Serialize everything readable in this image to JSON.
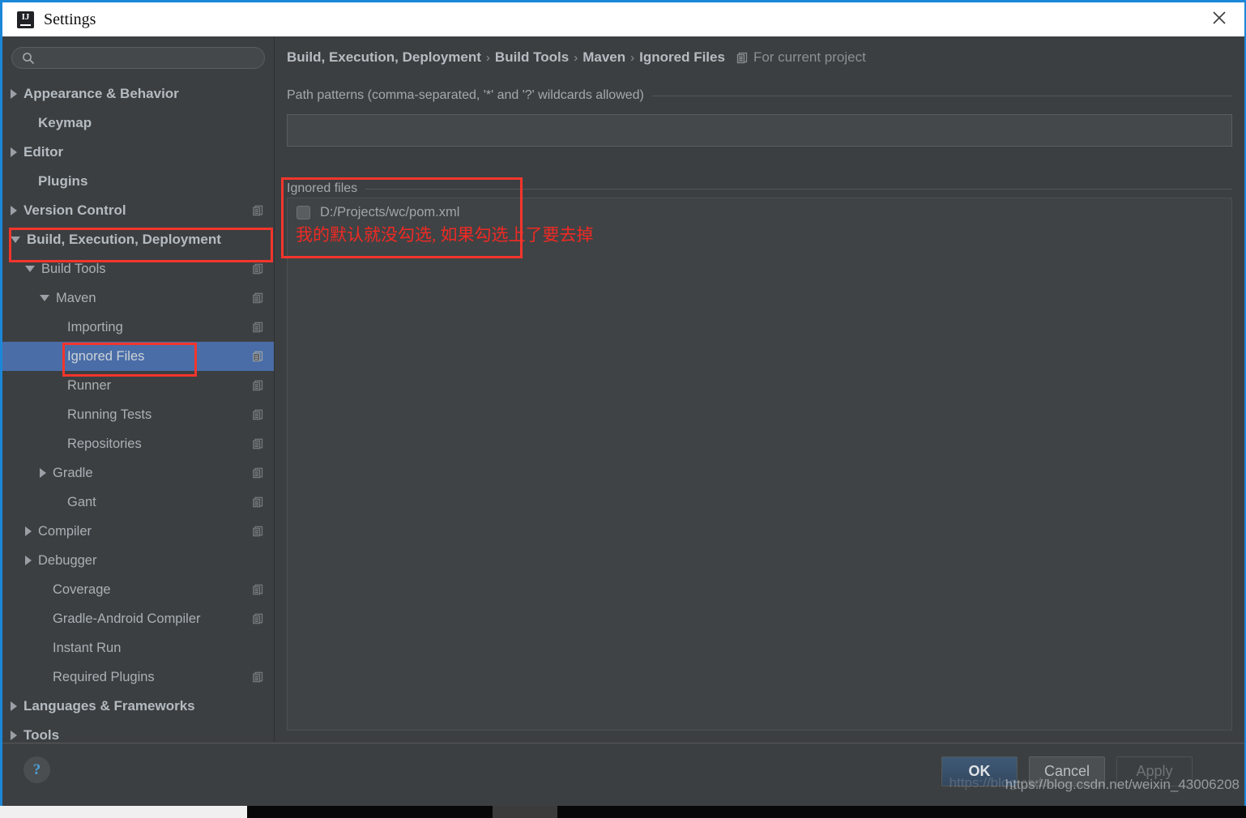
{
  "window": {
    "title": "Settings",
    "logo_text": "IJ",
    "close_icon": "close-icon",
    "accent_color": "#1b87d8"
  },
  "search": {
    "value": "",
    "placeholder": "",
    "icon": "search-icon"
  },
  "sidebar": {
    "items": [
      {
        "label": "Appearance & Behavior",
        "indent": 0,
        "arrow": "right",
        "bold": true,
        "project_icon": false,
        "selected": false
      },
      {
        "label": "Keymap",
        "indent": 1,
        "arrow": "none",
        "bold": true,
        "project_icon": false,
        "selected": false
      },
      {
        "label": "Editor",
        "indent": 0,
        "arrow": "right",
        "bold": true,
        "project_icon": false,
        "selected": false
      },
      {
        "label": "Plugins",
        "indent": 1,
        "arrow": "none",
        "bold": true,
        "project_icon": false,
        "selected": false
      },
      {
        "label": "Version Control",
        "indent": 0,
        "arrow": "right",
        "bold": true,
        "project_icon": true,
        "selected": false
      },
      {
        "label": "Build, Execution, Deployment",
        "indent": 0,
        "arrow": "down",
        "bold": true,
        "project_icon": false,
        "selected": false
      },
      {
        "label": "Build Tools",
        "indent": 1,
        "arrow": "down",
        "bold": false,
        "project_icon": true,
        "selected": false
      },
      {
        "label": "Maven",
        "indent": 2,
        "arrow": "down",
        "bold": false,
        "project_icon": true,
        "selected": false
      },
      {
        "label": "Importing",
        "indent": 3,
        "arrow": "none",
        "bold": false,
        "project_icon": true,
        "selected": false
      },
      {
        "label": "Ignored Files",
        "indent": 3,
        "arrow": "none",
        "bold": false,
        "project_icon": true,
        "selected": true
      },
      {
        "label": "Runner",
        "indent": 3,
        "arrow": "none",
        "bold": false,
        "project_icon": true,
        "selected": false
      },
      {
        "label": "Running Tests",
        "indent": 3,
        "arrow": "none",
        "bold": false,
        "project_icon": true,
        "selected": false
      },
      {
        "label": "Repositories",
        "indent": 3,
        "arrow": "none",
        "bold": false,
        "project_icon": true,
        "selected": false
      },
      {
        "label": "Gradle",
        "indent": 2,
        "arrow": "right",
        "bold": false,
        "project_icon": true,
        "selected": false
      },
      {
        "label": "Gant",
        "indent": 3,
        "arrow": "none",
        "bold": false,
        "project_icon": true,
        "selected": false
      },
      {
        "label": "Compiler",
        "indent": 1,
        "arrow": "right",
        "bold": false,
        "project_icon": true,
        "selected": false
      },
      {
        "label": "Debugger",
        "indent": 1,
        "arrow": "right",
        "bold": false,
        "project_icon": false,
        "selected": false
      },
      {
        "label": "Coverage",
        "indent": 2,
        "arrow": "none",
        "bold": false,
        "project_icon": true,
        "selected": false
      },
      {
        "label": "Gradle-Android Compiler",
        "indent": 2,
        "arrow": "none",
        "bold": false,
        "project_icon": true,
        "selected": false
      },
      {
        "label": "Instant Run",
        "indent": 2,
        "arrow": "none",
        "bold": false,
        "project_icon": false,
        "selected": false
      },
      {
        "label": "Required Plugins",
        "indent": 2,
        "arrow": "none",
        "bold": false,
        "project_icon": true,
        "selected": false
      },
      {
        "label": "Languages & Frameworks",
        "indent": 0,
        "arrow": "right",
        "bold": true,
        "project_icon": false,
        "selected": false
      },
      {
        "label": "Tools",
        "indent": 0,
        "arrow": "right",
        "bold": true,
        "project_icon": false,
        "selected": false
      }
    ]
  },
  "main": {
    "breadcrumb": [
      "Build, Execution, Deployment",
      "Build Tools",
      "Maven",
      "Ignored Files"
    ],
    "breadcrumb_separator": "›",
    "scope_label": "For current project",
    "scope_icon": "project-scope-icon",
    "patterns_group_title": "Path patterns (comma-separated, '*' and '?' wildcards allowed)",
    "patterns_value": "",
    "patterns_placeholder": "",
    "ignored_group_title": "Ignored files",
    "ignored_files": [
      {
        "path": "D:/Projects/wc/pom.xml",
        "checked": false
      }
    ],
    "annotation": "我的默认就没勾选, 如果勾选上了要去掉",
    "annotation_color": "#ef2a24"
  },
  "footer": {
    "help_label": "?",
    "ok_label": "OK",
    "cancel_label": "Cancel",
    "apply_label": "Apply"
  },
  "watermark": {
    "url": "https://blog.csdn.net/weixin_43006208",
    "ghost": "https://blog.csd"
  }
}
